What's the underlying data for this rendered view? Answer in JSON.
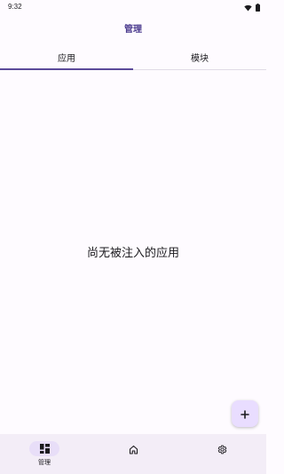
{
  "status_bar": {
    "time": "9:32",
    "icons": [
      "wifi-icon",
      "battery-icon"
    ]
  },
  "app_bar": {
    "title": "管理"
  },
  "tabs": [
    {
      "label": "应用",
      "selected": true
    },
    {
      "label": "模块",
      "selected": false
    }
  ],
  "main": {
    "empty_message": "尚无被注入的应用"
  },
  "fab": {
    "icon": "plus-icon"
  },
  "bottom_nav": {
    "items": [
      {
        "icon": "dashboard-icon",
        "label": "管理",
        "selected": true
      },
      {
        "icon": "home-icon",
        "label": "",
        "selected": false
      },
      {
        "icon": "gear-icon",
        "label": "",
        "selected": false
      }
    ]
  },
  "colors": {
    "background": "#fefbff",
    "accent": "#5b4a9a",
    "title": "#4b3b8f",
    "fab": "#e9ddff",
    "nav_background": "#f3edf7",
    "nav_indicator": "#e8def8"
  }
}
